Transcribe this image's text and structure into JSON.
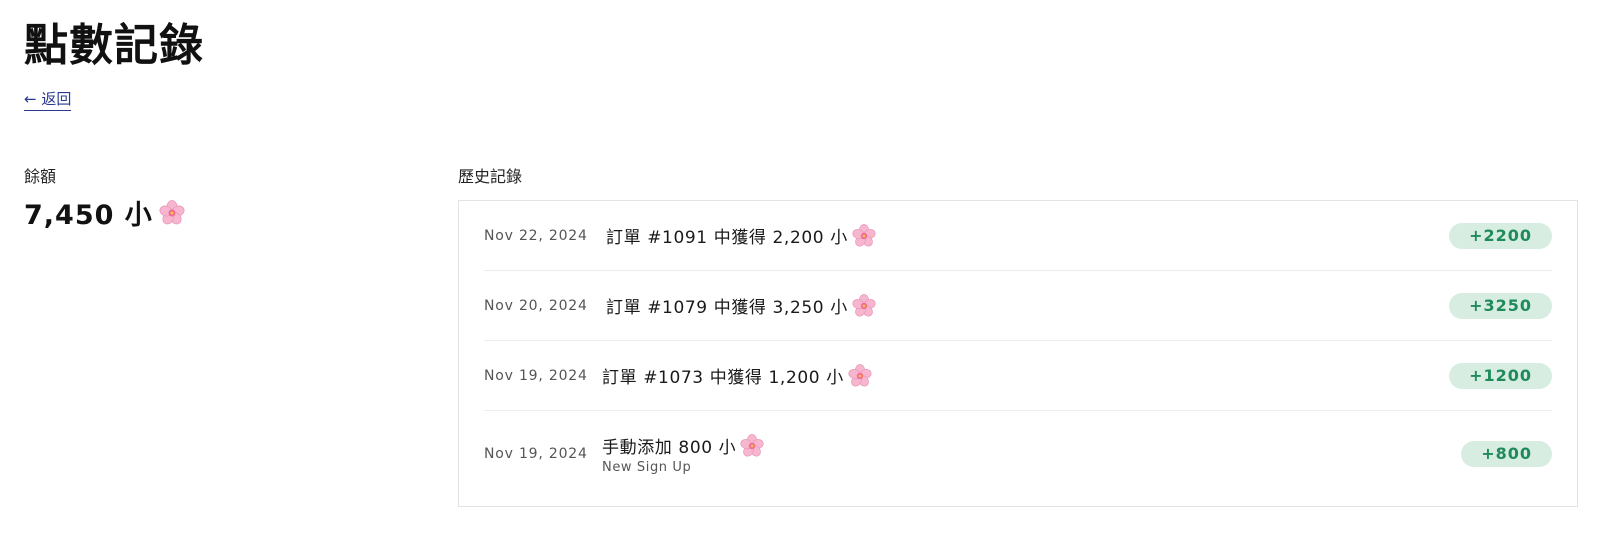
{
  "page": {
    "title": "點數記錄",
    "back_label": "← 返回"
  },
  "balance": {
    "label": "餘額",
    "value": "7,450 小",
    "icon": "cherry-blossom-icon"
  },
  "history": {
    "label": "歷史記錄",
    "badge_bg": "#d7ede2",
    "badge_fg": "#1f8a5a",
    "entries": [
      {
        "date": "Nov 22, 2024",
        "description": "訂單 #1091 中獲得 2,200 小",
        "subtitle": "",
        "amount": "+2200",
        "icon": "cherry-blossom-icon"
      },
      {
        "date": "Nov 20, 2024",
        "description": "訂單 #1079 中獲得 3,250 小",
        "subtitle": "",
        "amount": "+3250",
        "icon": "cherry-blossom-icon"
      },
      {
        "date": "Nov 19, 2024",
        "description": "訂單 #1073 中獲得 1,200 小",
        "subtitle": "",
        "amount": "+1200",
        "icon": "cherry-blossom-icon"
      },
      {
        "date": "Nov 19, 2024",
        "description": "手動添加 800 小",
        "subtitle": "New Sign Up",
        "amount": "+800",
        "icon": "cherry-blossom-icon"
      }
    ]
  }
}
